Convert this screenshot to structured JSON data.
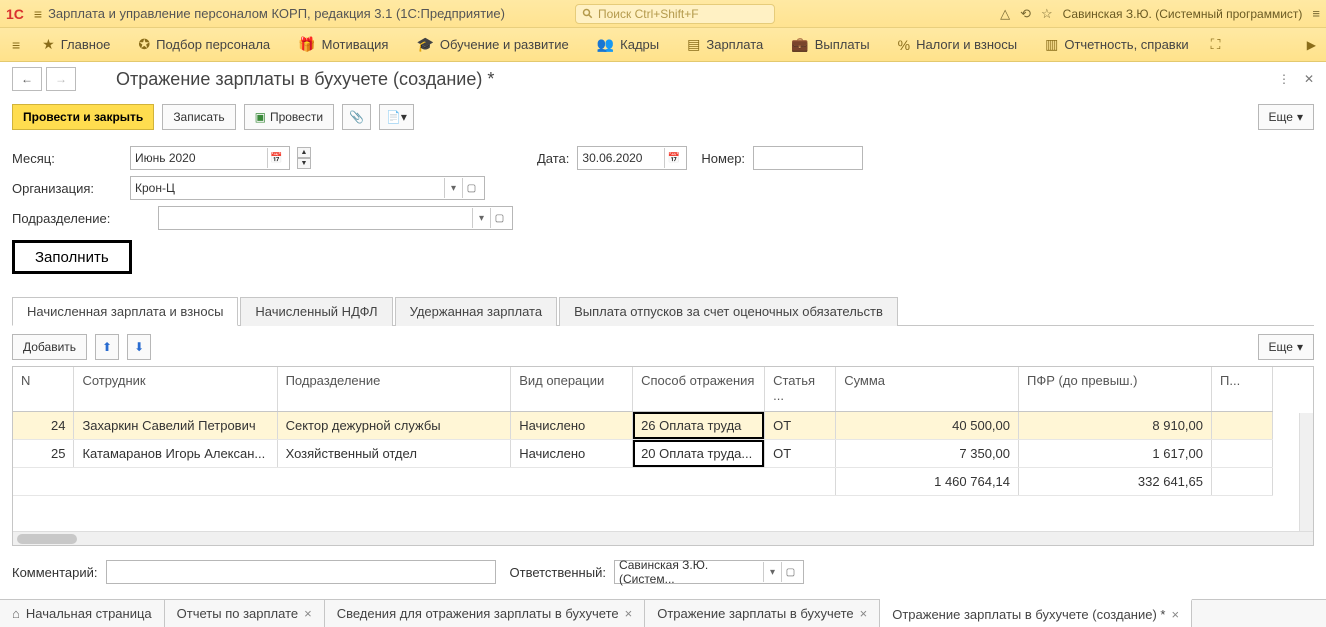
{
  "app": {
    "title": "Зарплата и управление персоналом КОРП, редакция 3.1  (1С:Предприятие)"
  },
  "search": {
    "placeholder": "Поиск Ctrl+Shift+F"
  },
  "user": "Савинская З.Ю. (Системный программист)",
  "menu": {
    "items": [
      "Главное",
      "Подбор персонала",
      "Мотивация",
      "Обучение и развитие",
      "Кадры",
      "Зарплата",
      "Выплаты",
      "Налоги и взносы",
      "Отчетность, справки"
    ]
  },
  "page": {
    "title": "Отражение зарплаты в бухучете (создание) *"
  },
  "toolbar": {
    "post_close": "Провести и закрыть",
    "write": "Записать",
    "post": "Провести",
    "more": "Еще"
  },
  "form": {
    "month_label": "Месяц:",
    "month_value": "Июнь 2020",
    "date_label": "Дата:",
    "date_value": "30.06.2020",
    "number_label": "Номер:",
    "number_value": "",
    "org_label": "Организация:",
    "org_value": "Крон-Ц",
    "dept_label": "Подразделение:",
    "dept_value": ""
  },
  "fill_button": "Заполнить",
  "tabs": [
    "Начисленная зарплата и взносы",
    "Начисленный НДФЛ",
    "Удержанная зарплата",
    "Выплата отпусков за счет оценочных обязательств"
  ],
  "subtoolbar": {
    "add": "Добавить",
    "more": "Еще"
  },
  "table": {
    "headers": {
      "n": "N",
      "emp": "Сотрудник",
      "dept": "Подразделение",
      "op": "Вид операции",
      "way": "Способ отражения",
      "art": "Статья ...",
      "sum": "Сумма",
      "pfr": "ПФР (до превыш.)",
      "rest": "П..."
    },
    "rows": [
      {
        "n": "24",
        "emp": "Захаркин Савелий Петрович",
        "dept": "Сектор дежурной службы",
        "op": "Начислено",
        "way": "26 Оплата труда",
        "art": "ОТ",
        "sum": "40 500,00",
        "pfr": "8 910,00"
      },
      {
        "n": "25",
        "emp": "Катамаранов Игорь Алексан...",
        "dept": "Хозяйственный отдел",
        "op": "Начислено",
        "way": "20 Оплата труда...",
        "art": "ОТ",
        "sum": "7 350,00",
        "pfr": "1 617,00"
      }
    ],
    "totals": {
      "sum": "1 460 764,14",
      "pfr": "332 641,65"
    }
  },
  "comment": {
    "label": "Комментарий:",
    "resp_label": "Ответственный:",
    "resp_value": "Савинская З.Ю. (Систем..."
  },
  "footer_tabs": [
    "Начальная страница",
    "Отчеты по зарплате",
    "Сведения для отражения зарплаты в бухучете",
    "Отражение зарплаты в бухучете",
    "Отражение зарплаты в бухучете (создание) *"
  ]
}
